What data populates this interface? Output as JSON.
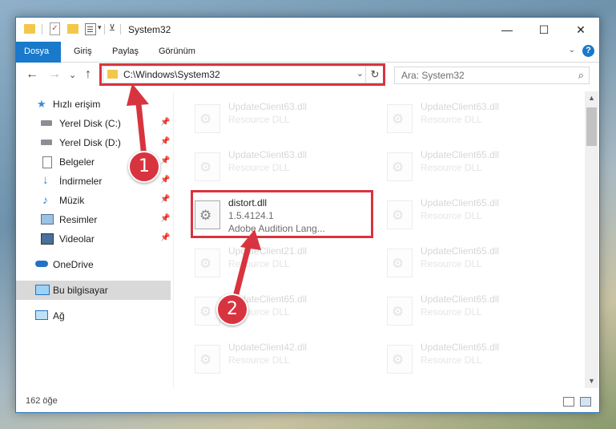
{
  "window": {
    "title": "System32",
    "minimize": "—",
    "maximize": "☐",
    "close": "✕"
  },
  "ribbon": {
    "tabs": [
      "Dosya",
      "Giriş",
      "Paylaş",
      "Görünüm"
    ],
    "help": "?",
    "collapse": "⌄"
  },
  "nav": {
    "back": "←",
    "forward": "→",
    "recent": "⌄",
    "up": "↑",
    "address": "C:\\Windows\\System32",
    "dropdown": "⌄",
    "refresh": "↻",
    "search_placeholder": "Ara: System32",
    "search_icon": "⌕"
  },
  "sidebar": {
    "items": [
      {
        "label": "Hızlı erişim",
        "icon": "star-icon"
      },
      {
        "label": "Yerel Disk (C:)",
        "icon": "drive-icon",
        "pinned": true
      },
      {
        "label": "Yerel Disk (D:)",
        "icon": "drive-icon",
        "pinned": true
      },
      {
        "label": "Belgeler",
        "icon": "documents-icon",
        "pinned": true
      },
      {
        "label": "İndirmeler",
        "icon": "download-icon",
        "pinned": true
      },
      {
        "label": "Müzik",
        "icon": "music-icon",
        "pinned": true
      },
      {
        "label": "Resimler",
        "icon": "pictures-icon",
        "pinned": true
      },
      {
        "label": "Videolar",
        "icon": "videos-icon",
        "pinned": true
      },
      {
        "label": "OneDrive",
        "icon": "cloud-icon"
      },
      {
        "label": "Bu bilgisayar",
        "icon": "computer-icon",
        "selected": true
      },
      {
        "label": "Ağ",
        "icon": "network-icon"
      }
    ]
  },
  "files": {
    "selected": {
      "name": "distort.dll",
      "version": "1.5.4124.1",
      "description": "Adobe Audition Lang..."
    },
    "ghosts": [
      {
        "name": "UpdateClient63.dll",
        "type": "Resource DLL"
      },
      {
        "name": "UpdateClient63.dll",
        "type": "Resource DLL"
      },
      {
        "name": "UpdateClient63.dll",
        "type": "Resource DLL"
      },
      {
        "name": "UpdateClient65.dll",
        "type": "Resource DLL"
      },
      {
        "name": "UpdateClient65.dll",
        "type": "Resource DLL"
      },
      {
        "name": "UpdateClient21.dll",
        "type": "Resource DLL"
      },
      {
        "name": "UpdateClient65.dll",
        "type": "Resource DLL"
      },
      {
        "name": "UpdateClient65.dll",
        "type": "Resource DLL"
      },
      {
        "name": "UpdateClient65.dll",
        "type": "Resource DLL"
      },
      {
        "name": "UpdateClient42.dll",
        "type": "Resource DLL"
      },
      {
        "name": "UpdateClient65.dll",
        "type": "Resource DLL"
      }
    ]
  },
  "status": {
    "count": "162 öğe"
  },
  "callouts": {
    "one": "1",
    "two": "2"
  },
  "colors": {
    "accent": "#1979ca",
    "highlight": "#d8343f",
    "folder": "#f3c74b"
  }
}
